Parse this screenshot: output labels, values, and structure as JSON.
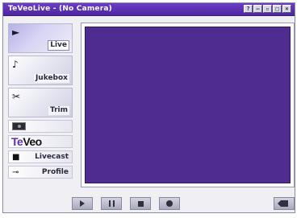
{
  "window": {
    "title": "TeVeoLive - (No Camera)",
    "buttons": [
      "?",
      "—",
      "▫",
      "□",
      "×"
    ]
  },
  "sidebar": {
    "tiles": [
      {
        "label": "Live",
        "icon": "play-icon"
      },
      {
        "label": "Jukebox",
        "icon": "guitar-icon"
      },
      {
        "label": "Trim",
        "icon": "scissors-icon"
      }
    ],
    "camera_icon": "camera-icon",
    "logo": {
      "part1": "Te",
      "part2": "Veo"
    },
    "livecast": {
      "label": "Livecast",
      "icon": "person-icon"
    },
    "profile": {
      "label": "Profile",
      "icon": "key-icon"
    }
  },
  "video": {
    "background": "#4f2c8f"
  },
  "controls": [
    "play-icon",
    "pause-icon",
    "stop-icon",
    "record-icon"
  ],
  "side_control": "rewind-icon"
}
